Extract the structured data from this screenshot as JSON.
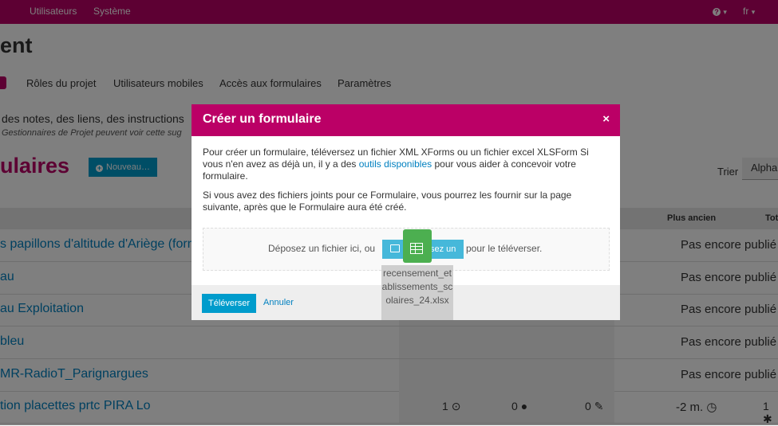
{
  "topbar": {
    "nav_users": "Utilisateurs",
    "nav_system": "Système",
    "help_icon": "question-icon",
    "help_caret": "▾",
    "lang": "fr",
    "lang_caret": "▾"
  },
  "page": {
    "title": "ent"
  },
  "tabs": [
    "Rôles du projet",
    "Utilisateurs mobiles",
    "Accès aux formulaires",
    "Paramètres"
  ],
  "notes": {
    "line1": "des notes, des liens, des instructions",
    "line2": "Gestionnaires de Projet peuvent voir cette sug"
  },
  "forms": {
    "title": "ulaires",
    "new_button": "Nouveau…",
    "sort_label": "Trier",
    "sort_value": "Alphab"
  },
  "table": {
    "headers": {
      "oldest": "Plus ancien",
      "total": "Tot"
    },
    "rows": [
      {
        "name": "s papillons d'altitude d'Ariège (form",
        "status": "Pas encore publié"
      },
      {
        "name": "au",
        "status": "Pas encore publié"
      },
      {
        "name": "au Exploitation",
        "status": "Pas encore publié"
      },
      {
        "name": "bleu",
        "status": "Pas encore publié"
      },
      {
        "name": "MR-RadioT_Parignargues",
        "status": "Pas encore publié"
      },
      {
        "name": "tion placettes prtc PIRA Lo",
        "c1": "1",
        "c2": "0",
        "c3": "0",
        "status": "-2 m.",
        "c4": "1"
      }
    ]
  },
  "modal": {
    "title": "Créer un formulaire",
    "close": "×",
    "p1_before": "Pour créer un formulaire, téléversez un fichier XML XForms ou un fichier excel XLSForm Si vous n'en avez as déjà un, il y a des ",
    "p1_link": "outils disponibles",
    "p1_after": " pour vous aider à concevoir votre formulaire.",
    "p2": "Si vous avez des fichiers joints pour ce Formulaire, vous pourrez les fournir sur la page suivante, après que le Formulaire aura été créé.",
    "drop_before": "Déposez un fichier ici, ou",
    "browse_visible": "sez un",
    "drop_after": "pour le téléverser.",
    "upload_button": "Téléverser",
    "cancel": "Annuler"
  },
  "drag": {
    "filename": "recensement_etablissements_scolaires_24.xlsx",
    "icon": "spreadsheet-icon"
  },
  "colors": {
    "brand": "#bb0066",
    "primary": "#009ccc",
    "link": "#0080c0",
    "file_green": "#4caf50"
  }
}
